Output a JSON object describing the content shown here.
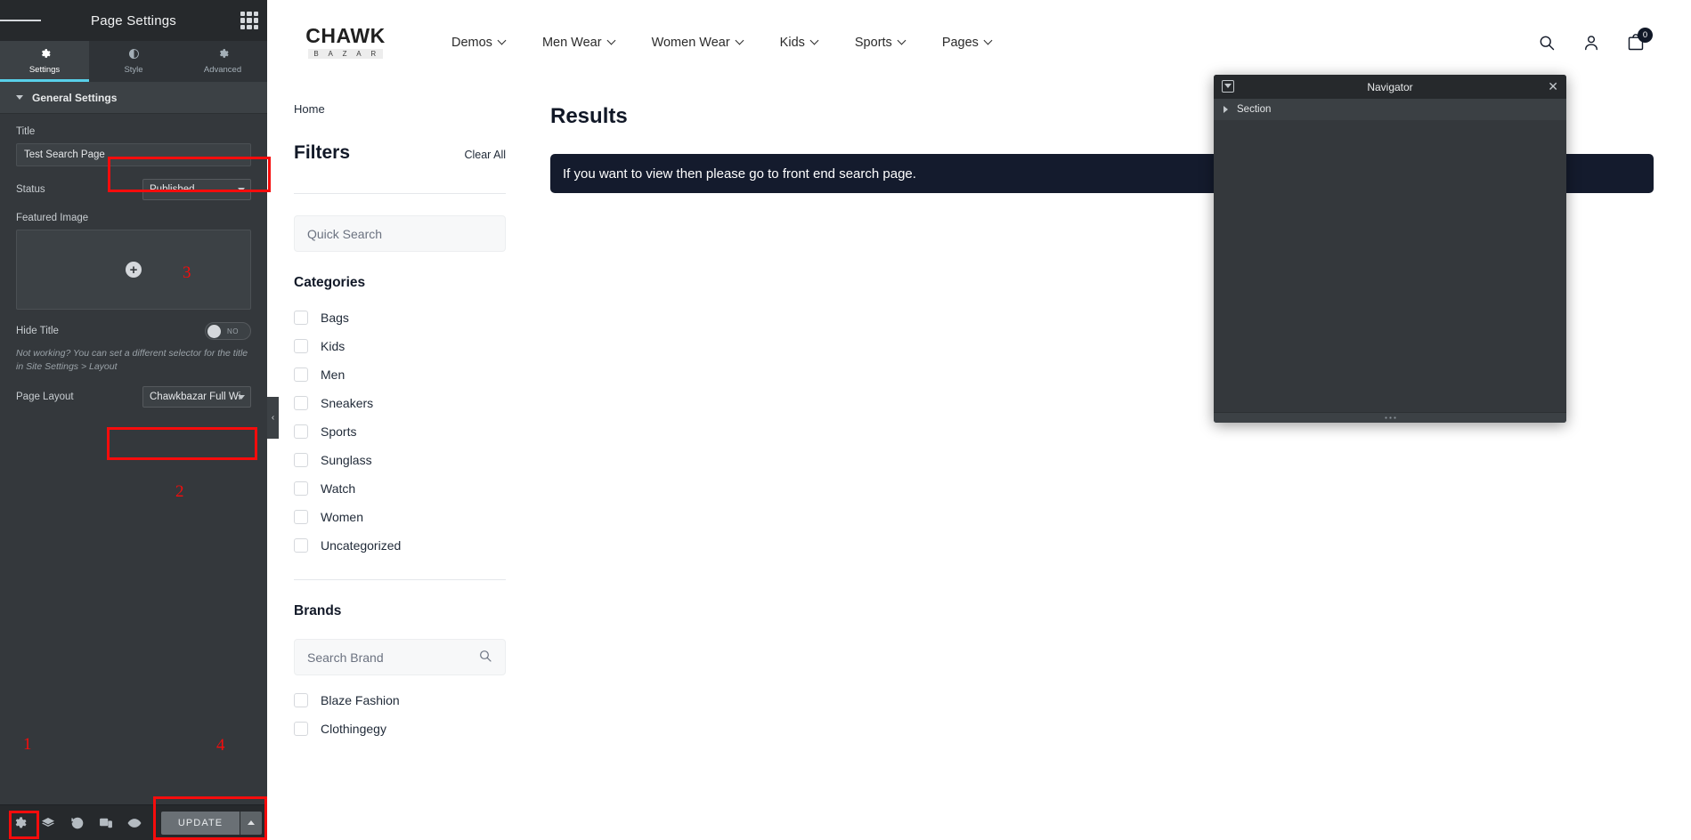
{
  "panel": {
    "title": "Page Settings",
    "menu_icon": "hamburger-icon",
    "grid_icon": "apps-grid-icon",
    "tabs": [
      {
        "label": "Settings",
        "icon": "gear-icon",
        "active": true
      },
      {
        "label": "Style",
        "icon": "contrast-icon",
        "active": false
      },
      {
        "label": "Advanced",
        "icon": "gear-advanced-icon",
        "active": false
      }
    ],
    "section": {
      "label": "General Settings"
    },
    "fields": {
      "title_label": "Title",
      "title_value": "Test Search Page",
      "status_label": "Status",
      "status_value": "Published",
      "featured_image_label": "Featured Image",
      "featured_image_add": "+",
      "hide_title_label": "Hide Title",
      "hide_title_value": "NO",
      "hint": "Not working? You can set a different selector for the title in Site Settings > Layout",
      "page_layout_label": "Page Layout",
      "page_layout_value": "Chawkbazar Full Wi"
    },
    "footer": {
      "icons": [
        "gear-icon",
        "layers-icon",
        "history-icon",
        "responsive-icon",
        "preview-eye-icon"
      ],
      "update_label": "UPDATE",
      "update_arrow": "chevron-up-icon"
    },
    "annotations": [
      {
        "number": "1"
      },
      {
        "number": "2"
      },
      {
        "number": "3"
      },
      {
        "number": "4"
      }
    ],
    "collapse_handle": "‹"
  },
  "site": {
    "logo": {
      "line1": "CHAWK",
      "line2": "B A Z A R"
    },
    "nav": [
      {
        "label": "Demos"
      },
      {
        "label": "Men Wear"
      },
      {
        "label": "Women Wear"
      },
      {
        "label": "Kids"
      },
      {
        "label": "Sports"
      },
      {
        "label": "Pages"
      }
    ],
    "actions": {
      "search_icon": "search-icon",
      "account_icon": "user-icon",
      "cart_icon": "cart-icon",
      "cart_count": "0"
    },
    "breadcrumb": "Home",
    "filters": {
      "title": "Filters",
      "clear_all": "Clear All",
      "quick_search_placeholder": "Quick Search",
      "categories_title": "Categories",
      "categories": [
        "Bags",
        "Kids",
        "Men",
        "Sneakers",
        "Sports",
        "Sunglass",
        "Watch",
        "Women",
        "Uncategorized"
      ],
      "brands_title": "Brands",
      "brand_search_placeholder": "Search Brand",
      "brand_search_icon": "search-icon",
      "brands": [
        "Blaze Fashion",
        "Clothingegy"
      ]
    },
    "results": {
      "title": "Results",
      "notice": "If you want to view then please go to front end search page."
    }
  },
  "navigator": {
    "title": "Navigator",
    "dock_icon": "dock-icon",
    "close_icon": "close-icon",
    "items": [
      {
        "label": "Section"
      }
    ],
    "resize_handle": "resize-dots-icon"
  },
  "colors": {
    "panel_bg": "#34383c",
    "panel_dark": "#26292c",
    "accent": "#58cfe8",
    "annotation_red": "#f60c0c",
    "notice_bg": "#141b2d"
  }
}
